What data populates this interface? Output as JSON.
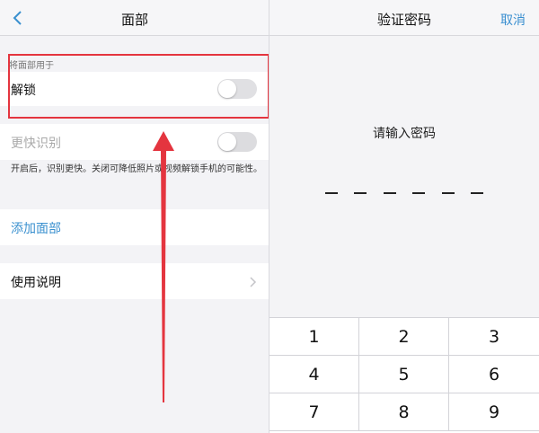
{
  "left": {
    "nav_title": "面部",
    "section_label": "将面部用于",
    "unlock_label": "解锁",
    "unlock_toggle": "off",
    "faster_label": "更快识别",
    "faster_toggle": "off",
    "desc": "开启后，识别更快。关闭可降低照片或视频解锁手机的可能性。",
    "add_face": "添加面部",
    "instructions": "使用说明"
  },
  "right": {
    "nav_title": "验证密码",
    "cancel": "取消",
    "prompt": "请输入密码",
    "passcode_length": 6,
    "keys": [
      "1",
      "2",
      "3",
      "4",
      "5",
      "6",
      "7",
      "8",
      "9"
    ]
  },
  "colors": {
    "accent": "#3a90cf",
    "highlight": "#e4353f"
  },
  "icons": [
    "back-chevron-icon",
    "chevron-right-icon"
  ]
}
